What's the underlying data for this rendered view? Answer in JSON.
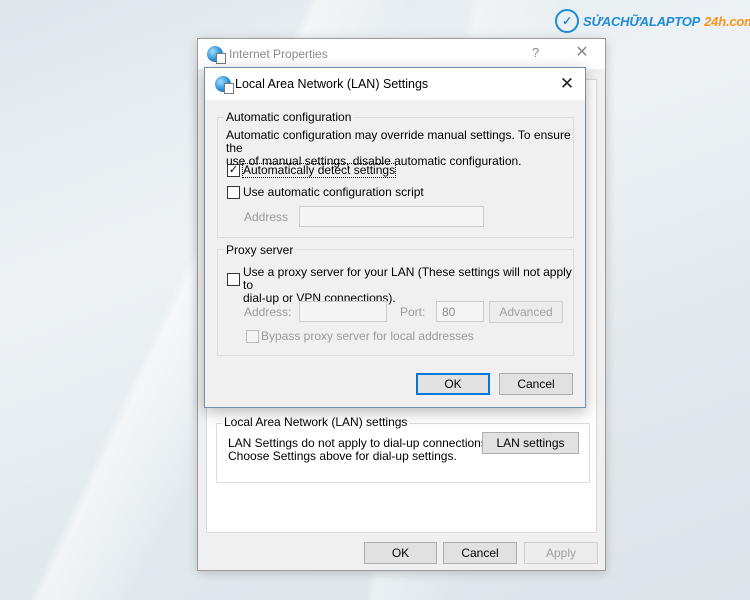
{
  "watermark": {
    "part1": "SỬACHỮALAPTOP",
    "part2": "24h.com"
  },
  "back_window": {
    "title": "Internet Properties",
    "help": "?",
    "close": "✕",
    "lan_section": {
      "label": "Local Area Network (LAN) settings",
      "note_line1": "LAN Settings do not apply to dial-up connections.",
      "note_line2": "Choose Settings above for dial-up settings.",
      "lan_settings_button": "LAN settings"
    },
    "buttons": {
      "ok": "OK",
      "cancel": "Cancel",
      "apply": "Apply"
    }
  },
  "dialog": {
    "title": "Local Area Network (LAN) Settings",
    "close": "✕",
    "auto_config": {
      "label": "Automatic configuration",
      "description_line1": "Automatic configuration may override manual settings.  To ensure the",
      "description_line2": "use of manual settings, disable automatic configuration.",
      "auto_detect_label": "Automatically detect settings",
      "auto_detect_checked": true,
      "auto_script_label": "Use automatic configuration script",
      "auto_script_checked": false,
      "address_label": "Address",
      "address_value": ""
    },
    "proxy": {
      "label": "Proxy server",
      "use_proxy_line1": "Use a proxy server for your LAN (These settings will not apply to",
      "use_proxy_line2": "dial-up or VPN connections).",
      "use_proxy_checked": false,
      "address_label": "Address:",
      "address_value": "",
      "port_label": "Port:",
      "port_value": "80",
      "advanced_button": "Advanced",
      "bypass_label": "Bypass proxy server for local addresses",
      "bypass_checked": false
    },
    "buttons": {
      "ok": "OK",
      "cancel": "Cancel"
    }
  }
}
